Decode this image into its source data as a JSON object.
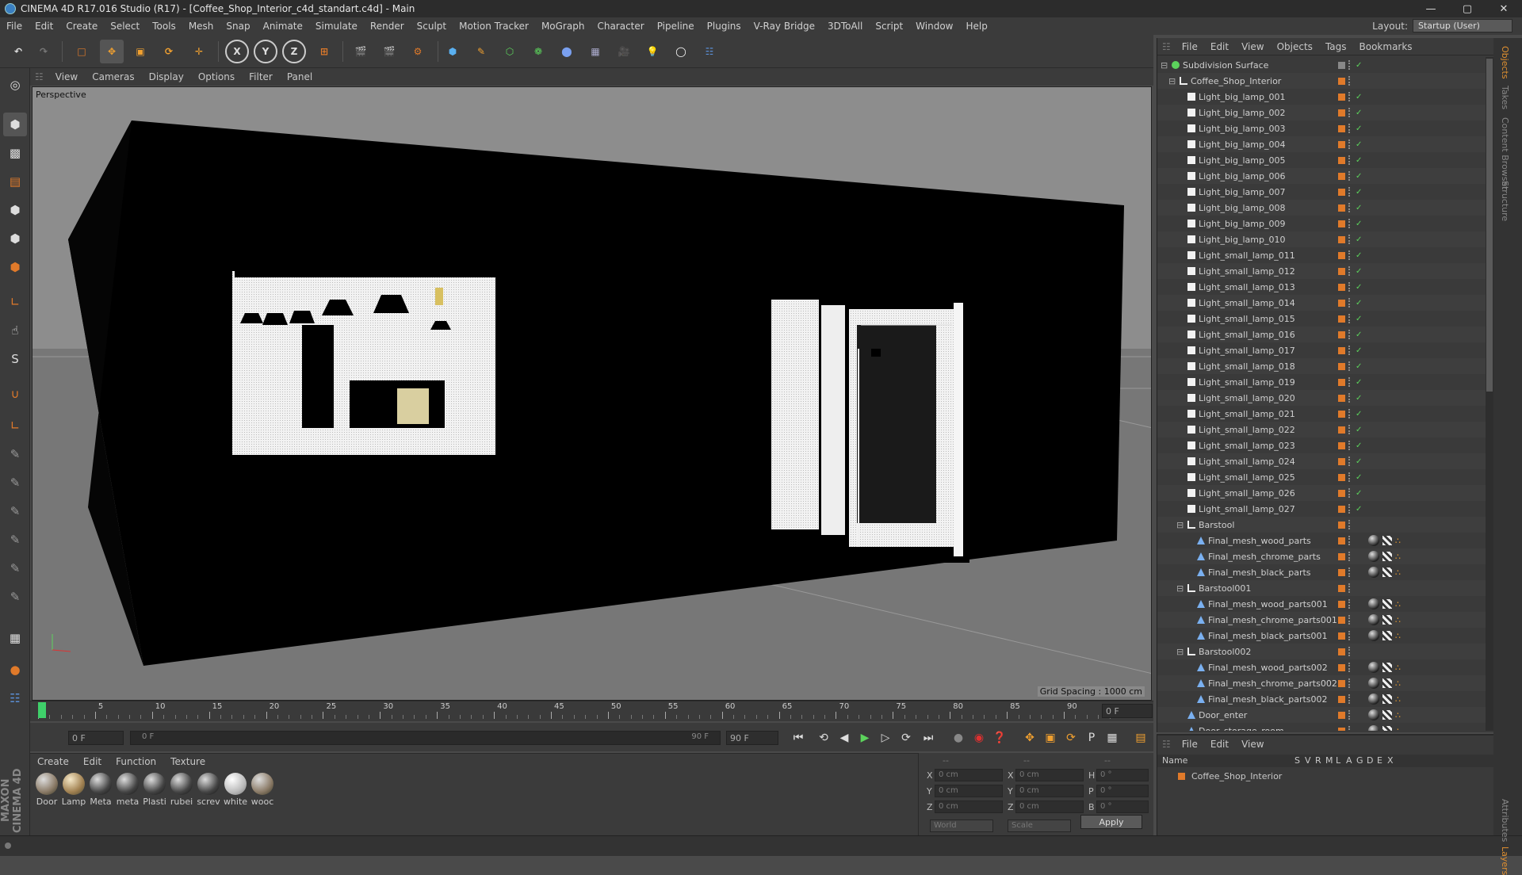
{
  "window": {
    "title": "CINEMA 4D R17.016 Studio (R17) - [Coffee_Shop_Interior_c4d_standart.c4d] - Main"
  },
  "menubar": [
    "File",
    "Edit",
    "Create",
    "Select",
    "Tools",
    "Mesh",
    "Snap",
    "Animate",
    "Simulate",
    "Render",
    "Sculpt",
    "Motion Tracker",
    "MoGraph",
    "Character",
    "Pipeline",
    "Plugins",
    "V-Ray Bridge",
    "3DToAll",
    "Script",
    "Window",
    "Help"
  ],
  "layout": {
    "label": "Layout:",
    "value": "Startup (User)"
  },
  "viewport": {
    "menu": [
      "View",
      "Cameras",
      "Display",
      "Options",
      "Filter",
      "Panel"
    ],
    "label": "Perspective",
    "grid_spacing": "Grid Spacing : 1000 cm"
  },
  "timeline": {
    "ticks": [
      "0",
      "5",
      "10",
      "15",
      "20",
      "25",
      "30",
      "35",
      "40",
      "45",
      "50",
      "55",
      "60",
      "65",
      "70",
      "75",
      "80",
      "85",
      "90"
    ],
    "end_field": "0 F"
  },
  "transport": {
    "current_frame": "0 F",
    "range_start": "0 F",
    "range_end": "90 F",
    "max_frame": "90 F"
  },
  "materials": {
    "menu": [
      "Create",
      "Edit",
      "Function",
      "Texture"
    ],
    "items": [
      "Door",
      "Lamp",
      "Meta",
      "meta",
      "Plasti",
      "rubei",
      "screv",
      "white",
      "wooc"
    ]
  },
  "coordinates": {
    "labels": {
      "x": "X",
      "y": "Y",
      "z": "Z",
      "h": "H",
      "p": "P",
      "b": "B"
    },
    "pos": [
      "0 cm",
      "0 cm",
      "0 cm"
    ],
    "size": [
      "0 cm",
      "0 cm",
      "0 cm"
    ],
    "rot": [
      "0 °",
      "0 °",
      "0 °"
    ],
    "header": [
      "--",
      "--",
      "--"
    ],
    "mode": "World",
    "scale_mode": "Scale",
    "apply": "Apply"
  },
  "objects_panel": {
    "menu": [
      "File",
      "Edit",
      "View",
      "Objects",
      "Tags",
      "Bookmarks"
    ],
    "items": [
      {
        "name": "Subdivision Surface",
        "level": 0,
        "icon": "subdiv-icon",
        "checked": true
      },
      {
        "name": "Coffee_Shop_Interior",
        "level": 1,
        "icon": "null-icon",
        "checked": false
      },
      {
        "name": "Light_big_lamp_001",
        "level": 2,
        "icon": "light-icon",
        "checked": true
      },
      {
        "name": "Light_big_lamp_002",
        "level": 2,
        "icon": "light-icon",
        "checked": true
      },
      {
        "name": "Light_big_lamp_003",
        "level": 2,
        "icon": "light-icon",
        "checked": true
      },
      {
        "name": "Light_big_lamp_004",
        "level": 2,
        "icon": "light-icon",
        "checked": true
      },
      {
        "name": "Light_big_lamp_005",
        "level": 2,
        "icon": "light-icon",
        "checked": true
      },
      {
        "name": "Light_big_lamp_006",
        "level": 2,
        "icon": "light-icon",
        "checked": true
      },
      {
        "name": "Light_big_lamp_007",
        "level": 2,
        "icon": "light-icon",
        "checked": true
      },
      {
        "name": "Light_big_lamp_008",
        "level": 2,
        "icon": "light-icon",
        "checked": true
      },
      {
        "name": "Light_big_lamp_009",
        "level": 2,
        "icon": "light-icon",
        "checked": true
      },
      {
        "name": "Light_big_lamp_010",
        "level": 2,
        "icon": "light-icon",
        "checked": true
      },
      {
        "name": "Light_small_lamp_011",
        "level": 2,
        "icon": "light-icon",
        "checked": true
      },
      {
        "name": "Light_small_lamp_012",
        "level": 2,
        "icon": "light-icon",
        "checked": true
      },
      {
        "name": "Light_small_lamp_013",
        "level": 2,
        "icon": "light-icon",
        "checked": true
      },
      {
        "name": "Light_small_lamp_014",
        "level": 2,
        "icon": "light-icon",
        "checked": true
      },
      {
        "name": "Light_small_lamp_015",
        "level": 2,
        "icon": "light-icon",
        "checked": true
      },
      {
        "name": "Light_small_lamp_016",
        "level": 2,
        "icon": "light-icon",
        "checked": true
      },
      {
        "name": "Light_small_lamp_017",
        "level": 2,
        "icon": "light-icon",
        "checked": true
      },
      {
        "name": "Light_small_lamp_018",
        "level": 2,
        "icon": "light-icon",
        "checked": true
      },
      {
        "name": "Light_small_lamp_019",
        "level": 2,
        "icon": "light-icon",
        "checked": true
      },
      {
        "name": "Light_small_lamp_020",
        "level": 2,
        "icon": "light-icon",
        "checked": true
      },
      {
        "name": "Light_small_lamp_021",
        "level": 2,
        "icon": "light-icon",
        "checked": true
      },
      {
        "name": "Light_small_lamp_022",
        "level": 2,
        "icon": "light-icon",
        "checked": true
      },
      {
        "name": "Light_small_lamp_023",
        "level": 2,
        "icon": "light-icon",
        "checked": true
      },
      {
        "name": "Light_small_lamp_024",
        "level": 2,
        "icon": "light-icon",
        "checked": true
      },
      {
        "name": "Light_small_lamp_025",
        "level": 2,
        "icon": "light-icon",
        "checked": true
      },
      {
        "name": "Light_small_lamp_026",
        "level": 2,
        "icon": "light-icon",
        "checked": true
      },
      {
        "name": "Light_small_lamp_027",
        "level": 2,
        "icon": "light-icon",
        "checked": true
      },
      {
        "name": "Barstool",
        "level": 2,
        "icon": "null-icon",
        "checked": false
      },
      {
        "name": "Final_mesh_wood_parts",
        "level": 3,
        "icon": "mesh-icon",
        "checked": false,
        "mats": true
      },
      {
        "name": "Final_mesh_chrome_parts",
        "level": 3,
        "icon": "mesh-icon",
        "checked": false,
        "mats": true
      },
      {
        "name": "Final_mesh_black_parts",
        "level": 3,
        "icon": "mesh-icon",
        "checked": false,
        "mats": true
      },
      {
        "name": "Barstool001",
        "level": 2,
        "icon": "null-icon",
        "checked": false
      },
      {
        "name": "Final_mesh_wood_parts001",
        "level": 3,
        "icon": "mesh-icon",
        "checked": false,
        "mats": true
      },
      {
        "name": "Final_mesh_chrome_parts001",
        "level": 3,
        "icon": "mesh-icon",
        "checked": false,
        "mats": true
      },
      {
        "name": "Final_mesh_black_parts001",
        "level": 3,
        "icon": "mesh-icon",
        "checked": false,
        "mats": true
      },
      {
        "name": "Barstool002",
        "level": 2,
        "icon": "null-icon",
        "checked": false
      },
      {
        "name": "Final_mesh_wood_parts002",
        "level": 3,
        "icon": "mesh-icon",
        "checked": false,
        "mats": true
      },
      {
        "name": "Final_mesh_chrome_parts002",
        "level": 3,
        "icon": "mesh-icon",
        "checked": false,
        "mats": true
      },
      {
        "name": "Final_mesh_black_parts002",
        "level": 3,
        "icon": "mesh-icon",
        "checked": false,
        "mats": true
      },
      {
        "name": "Door_enter",
        "level": 2,
        "icon": "mesh-icon",
        "checked": false,
        "mats": true
      },
      {
        "name": "Door_storage_room",
        "level": 2,
        "icon": "mesh-icon",
        "checked": false,
        "mats": true
      }
    ]
  },
  "side_tabs": [
    "Objects",
    "Takes",
    "Content Browser",
    "Structure",
    "Attributes",
    "Layers"
  ],
  "layers_panel": {
    "menu": [
      "File",
      "Edit",
      "View"
    ],
    "columns": [
      "Name",
      "S",
      "V",
      "R",
      "M",
      "L",
      "A",
      "G",
      "D",
      "E",
      "X"
    ],
    "row": "Coffee_Shop_Interior"
  },
  "colors": {
    "tag_orange": "#e07a2a",
    "check_green": "#5cd35c",
    "viewport_bg": "#8a8a8a",
    "accent_blue": "#3a7fc0"
  }
}
